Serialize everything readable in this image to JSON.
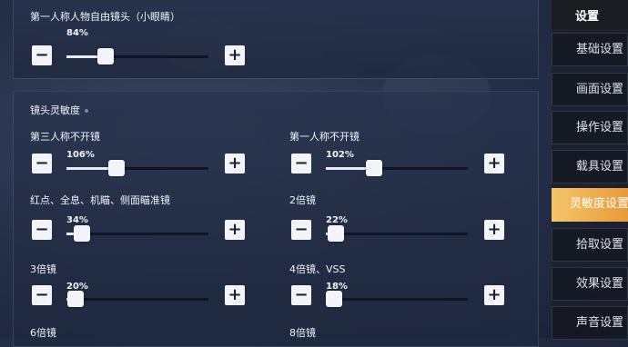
{
  "first_person_free_look": {
    "title": "第一人称人物自由镜头（小眼睛）",
    "percent": "84%",
    "value": 0.84
  },
  "camera_sensitivity": {
    "section_title": "镜头灵敏度",
    "items": [
      {
        "label": "第三人称不开镜",
        "percent": "106%",
        "value": 1.06
      },
      {
        "label": "第一人称不开镜",
        "percent": "102%",
        "value": 1.02
      },
      {
        "label": "红点、全息、机瞄、侧面瞄准镜",
        "percent": "34%",
        "value": 0.34
      },
      {
        "label": "2倍镜",
        "percent": "22%",
        "value": 0.22
      },
      {
        "label": "3倍镜",
        "percent": "20%",
        "value": 0.2
      },
      {
        "label": "4倍镜、VSS",
        "percent": "18%",
        "value": 0.18
      },
      {
        "label": "6倍镜"
      },
      {
        "label": "8倍镜"
      }
    ]
  },
  "controls": {
    "minus": "−",
    "plus": "+"
  },
  "sidebar": {
    "header": "设置",
    "items": [
      {
        "label": "基础设置"
      },
      {
        "label": "画面设置"
      },
      {
        "label": "操作设置"
      },
      {
        "label": "载具设置"
      },
      {
        "label": "灵敏度设置"
      },
      {
        "label": "拾取设置"
      },
      {
        "label": "效果设置"
      },
      {
        "label": "声音设置"
      }
    ],
    "active_label": "灵敏度设置"
  },
  "colors": {
    "accent": "#f0b050",
    "panel": "#28344e",
    "button": "#f3f4f6"
  }
}
